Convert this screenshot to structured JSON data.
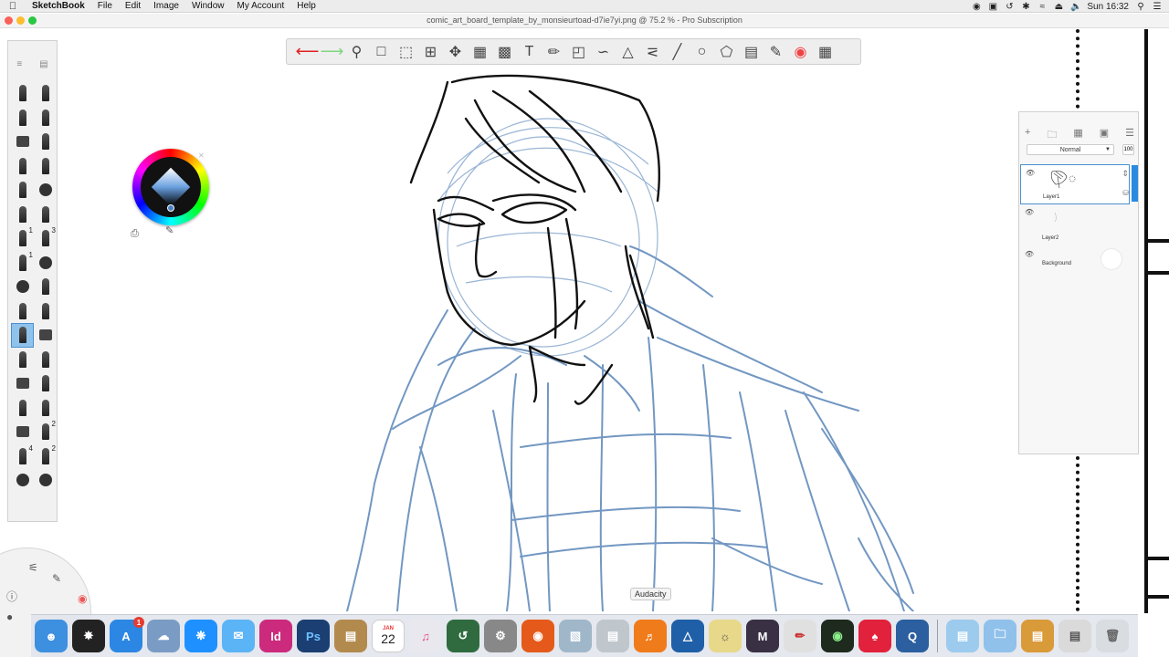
{
  "menubar": {
    "app_name": "SketchBook",
    "items": [
      "File",
      "Edit",
      "Image",
      "Window",
      "My Account",
      "Help"
    ],
    "clock": "Sun 16:32"
  },
  "window": {
    "title": "comic_art_board_template_by_monsieurtoad-d7ie7yi.png @ 75.2 % - Pro Subscription"
  },
  "toolbar": {
    "icons": [
      "undo-icon",
      "redo-icon",
      "zoom-icon",
      "select-icon",
      "lasso-select-icon",
      "crop-icon",
      "transform-icon",
      "distort-icon",
      "fill-icon",
      "text-icon",
      "ruler-icon",
      "ellipse-guide-icon",
      "french-curve-icon",
      "perspective-icon",
      "symmetry-icon",
      "line-icon",
      "circle-icon",
      "shape-icon",
      "layer-editor-icon",
      "brush-library-icon",
      "color-wheel-icon",
      "palette-grid-icon"
    ]
  },
  "tool_palette": {
    "badges": [
      "1",
      "3",
      "1",
      "2",
      "4",
      "2"
    ]
  },
  "layers": {
    "blend_mode": "Normal",
    "opacity": "100",
    "items": [
      {
        "name": "Layer1",
        "selected": true
      },
      {
        "name": "Layer2",
        "selected": false
      },
      {
        "name": "Background",
        "selected": false
      }
    ]
  },
  "dock": {
    "tooltip": "Audacity",
    "calendar_month": "JAN",
    "calendar_day": "22",
    "appstore_badge": "1",
    "labels": {
      "indesign": "Id",
      "photoshop": "Ps",
      "mari": "M"
    }
  },
  "colors": {
    "accent": "#2a8ae0",
    "sketch_blue": "#5a86b8",
    "ink": "#111111"
  }
}
